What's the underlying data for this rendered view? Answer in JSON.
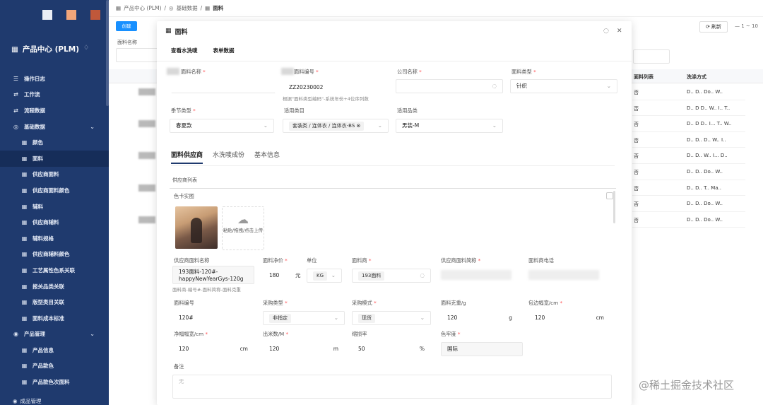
{
  "sidebar": {
    "dot_colors": [
      "#eaeef5",
      "#f2a67a",
      "#c0583a"
    ],
    "app_title": "产品中心 (PLM)",
    "items": [
      {
        "label": "操作日志",
        "level": 1,
        "icon": "list-icon"
      },
      {
        "label": "工作流",
        "level": 1,
        "icon": "workflow-icon"
      },
      {
        "label": "流程数据",
        "level": 1,
        "icon": "workflow-icon"
      },
      {
        "label": "基础数据",
        "level": 1,
        "icon": "database-icon",
        "expanded": true
      },
      {
        "label": "颜色",
        "level": 2,
        "icon": "table-icon"
      },
      {
        "label": "面料",
        "level": 2,
        "icon": "table-icon",
        "active": true
      },
      {
        "label": "供应商面料",
        "level": 2,
        "icon": "table-icon"
      },
      {
        "label": "供应商面料颜色",
        "level": 2,
        "icon": "table-icon"
      },
      {
        "label": "辅料",
        "level": 2,
        "icon": "table-icon"
      },
      {
        "label": "供应商辅料",
        "level": 2,
        "icon": "table-icon"
      },
      {
        "label": "辅料规格",
        "level": 2,
        "icon": "table-icon"
      },
      {
        "label": "供应商辅料颜色",
        "level": 2,
        "icon": "table-icon"
      },
      {
        "label": "工艺属性色系关联",
        "level": 2,
        "icon": "table-icon"
      },
      {
        "label": "报关品类关联",
        "level": 2,
        "icon": "table-icon"
      },
      {
        "label": "版型类目关联",
        "level": 2,
        "icon": "table-icon"
      },
      {
        "label": "面料成本标准",
        "level": 2,
        "icon": "table-icon"
      },
      {
        "label": "产品管理",
        "level": 1,
        "icon": "product-icon",
        "expanded": true
      },
      {
        "label": "产品信息",
        "level": 2,
        "icon": "table-icon"
      },
      {
        "label": "产品款色",
        "level": 2,
        "icon": "table-icon"
      },
      {
        "label": "产品款色次面料",
        "level": 2,
        "icon": "table-icon"
      }
    ],
    "bottom_item": "成品管理"
  },
  "breadcrumb": [
    "产品中心 (PLM)",
    "基础数据",
    "面料"
  ],
  "background": {
    "create_label": "创建",
    "filter_label": "面料名称",
    "refresh_label": "刷新",
    "pagination": "1 ~ 10",
    "columns": [
      "面料列表",
      "洗涤方式"
    ],
    "rows": [
      [
        "否",
        "D.. D.. Do.. W.."
      ],
      [
        "否",
        "D.. D D.. W.. I.. T.."
      ],
      [
        "否",
        "D.. D D.. I... T.. W.."
      ],
      [
        "否",
        "D.. D.. D.. W.. I.."
      ],
      [
        "否",
        "D.. D.. W.. I... D.."
      ],
      [
        "否",
        "D.. D.. Do.. W.."
      ],
      [
        "否",
        "D.. D.. T.. Ma.."
      ],
      [
        "否",
        "D.. D.. Do.. W.."
      ],
      [
        "否",
        "D.. D.. Do.. W.."
      ]
    ]
  },
  "modal": {
    "title": "面料",
    "toolbar": [
      "查看水洗唛",
      "表单数据"
    ],
    "fields": {
      "fabric_name_label": "面料名称",
      "fabric_name_value": "",
      "fabric_code_label": "面料编号",
      "fabric_code_value": "ZZ20230002",
      "fabric_code_hint": "根据\"面料类型编码\"-系统年份+4位序列数",
      "company_label": "公司名称",
      "company_value": "",
      "fabric_type_label": "面料类型",
      "fabric_type_value": "针织",
      "season_label": "季节类型",
      "season_value": "春夏款",
      "category_label": "适用类目",
      "category_value": "套装类 / 连体衣 / 连体衣-BS",
      "product_class_label": "适用品类",
      "product_class_value": "男装-M"
    },
    "tabs": [
      "面料供应商",
      "水洗唛成份",
      "基本信息"
    ],
    "active_tab": 0,
    "supplier": {
      "list_label": "供应商列表",
      "photo_label": "色卡实图",
      "upload_text": "粘贴/拖拽/点击上传",
      "sup_fabric_name_label": "供应商面料名称",
      "sup_fabric_name_value": "193面料-120#-happyNewYearGys-120g",
      "sup_fabric_name_hint": "面料商-编号#-面料简称-面料克重",
      "net_price_label": "面料净价",
      "net_price_value": "180",
      "net_price_unit": "元",
      "unit_label": "单位",
      "unit_value": "KG",
      "supplier_label": "面料商",
      "supplier_value": "193面料",
      "sup_short_label": "供应商面料简称",
      "sup_phone_label": "面料商电话",
      "fabric_no_label": "面料编号",
      "fabric_no_value": "120#",
      "purchase_type_label": "采购类型",
      "purchase_type_value": "非指定",
      "purchase_mode_label": "采购模式",
      "purchase_mode_value": "现货",
      "gram_weight_label": "面料克重/g",
      "gram_weight_value": "120",
      "gram_weight_unit": "g",
      "edge_width_label": "包边幅宽/cm",
      "edge_width_value": "120",
      "edge_width_unit": "cm",
      "net_width_label": "净幅幅宽/cm",
      "net_width_value": "120",
      "net_width_unit": "cm",
      "yield_label": "出米数/M",
      "yield_value": "120",
      "yield_unit": "m",
      "shrink_label": "缩损率",
      "shrink_value": "50",
      "shrink_unit": "%",
      "fastness_label": "色牢度",
      "fastness_value": "国际",
      "remark_label": "备注",
      "remark_placeholder": "无"
    }
  },
  "watermark": "@稀土掘金技术社区"
}
